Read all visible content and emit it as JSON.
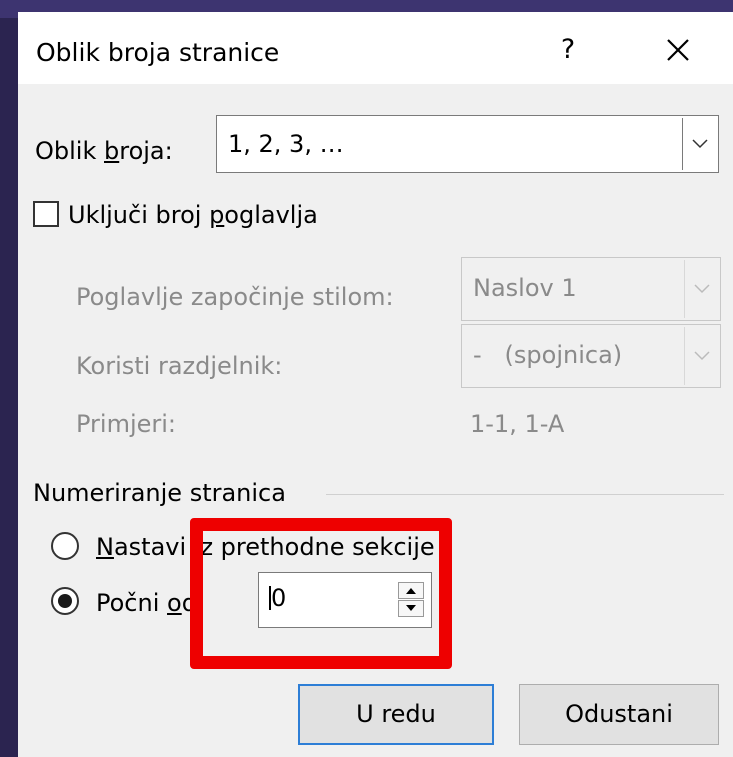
{
  "dialog": {
    "title": "Oblik broja stranice",
    "help_label": "?",
    "close_icon": "close-icon"
  },
  "format": {
    "label_pre": "Oblik ",
    "label_ul": "b",
    "label_post": "roja:",
    "value": "1, 2, 3, …"
  },
  "chapter": {
    "checkbox_pre": "Uključi broj ",
    "checkbox_ul": "p",
    "checkbox_post": "oglavlja",
    "checked": false,
    "style_label": "Poglavlje započinje stilom:",
    "style_value": "Naslov 1",
    "separator_label": "Koristi razdjelnik:",
    "separator_value": "-   (spojnica)",
    "examples_label": "Primjeri:",
    "examples_value": "1-1, 1-A"
  },
  "numbering": {
    "group_label": "Numeriranje stranica",
    "continue_ul": "N",
    "continue_post": "astavi iz prethodne sekcije",
    "start_pre": "Počni ",
    "start_ul": "o",
    "start_post": "d:",
    "start_value": "0",
    "selected": "start_at"
  },
  "buttons": {
    "ok": "U redu",
    "cancel": "Odustani"
  },
  "colors": {
    "highlight": "#ee0000",
    "default_button_border": "#2d7ed6",
    "background": "#2b2450"
  }
}
